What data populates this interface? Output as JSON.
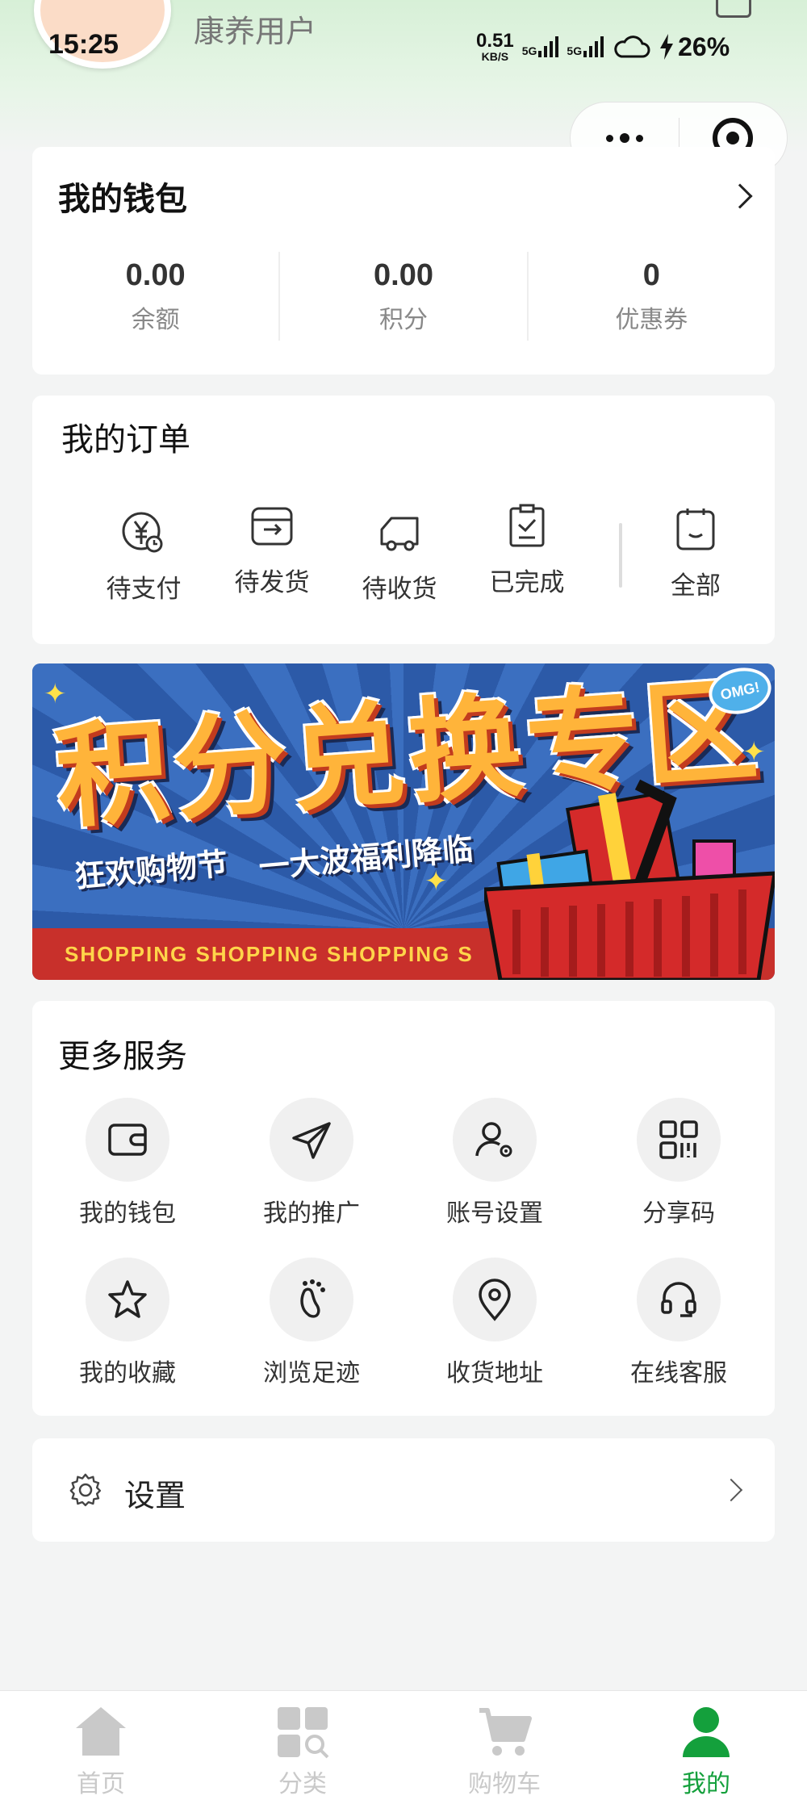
{
  "status_bar": {
    "time": "15:25",
    "net_speed_value": "0.51",
    "net_speed_unit": "KB/S",
    "signal1_label": "5G",
    "signal2_label": "5G",
    "battery": "26%"
  },
  "profile": {
    "username": "康养用户"
  },
  "wallet": {
    "title": "我的钱包",
    "stats": [
      {
        "value": "0.00",
        "label": "余额"
      },
      {
        "value": "0.00",
        "label": "积分"
      },
      {
        "value": "0",
        "label": "优惠券"
      }
    ]
  },
  "orders": {
    "title": "我的订单",
    "items": [
      {
        "label": "待支付",
        "icon": "yuan-clock-icon"
      },
      {
        "label": "待发货",
        "icon": "box-out-icon"
      },
      {
        "label": "待收货",
        "icon": "truck-icon"
      },
      {
        "label": "已完成",
        "icon": "clipboard-check-icon"
      },
      {
        "label": "全部",
        "icon": "clipboard-face-icon"
      }
    ]
  },
  "banner": {
    "title": "积分兑换专区",
    "subtitle_left": "狂欢购物节",
    "subtitle_right": "一大波福利降临",
    "strip_text": "SHOPPING SHOPPING SHOPPING S",
    "badge": "OMG!"
  },
  "services": {
    "title": "更多服务",
    "items": [
      {
        "label": "我的钱包",
        "icon": "wallet-icon"
      },
      {
        "label": "我的推广",
        "icon": "paper-plane-icon"
      },
      {
        "label": "账号设置",
        "icon": "user-gear-icon"
      },
      {
        "label": "分享码",
        "icon": "qr-code-icon"
      },
      {
        "label": "我的收藏",
        "icon": "star-icon"
      },
      {
        "label": "浏览足迹",
        "icon": "footprint-icon"
      },
      {
        "label": "收货地址",
        "icon": "location-pin-icon"
      },
      {
        "label": "在线客服",
        "icon": "headset-icon"
      }
    ]
  },
  "settings": {
    "label": "设置"
  },
  "tabbar": {
    "items": [
      {
        "label": "首页",
        "icon": "home-icon",
        "active": false
      },
      {
        "label": "分类",
        "icon": "category-icon",
        "active": false
      },
      {
        "label": "购物车",
        "icon": "cart-icon",
        "active": false
      },
      {
        "label": "我的",
        "icon": "user-icon",
        "active": true
      }
    ],
    "active_color": "#14a03c",
    "inactive_color": "#c9c9c9"
  }
}
